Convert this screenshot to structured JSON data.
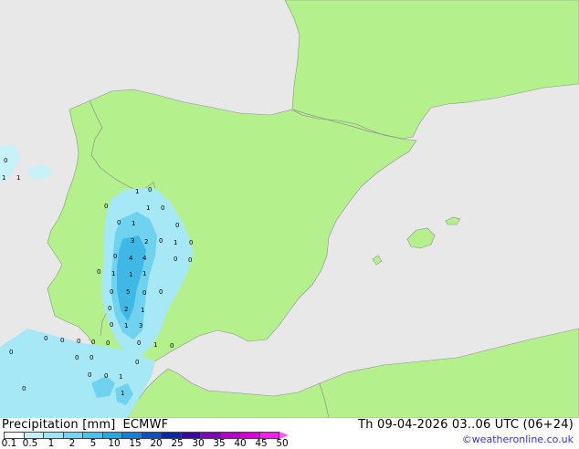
{
  "map": {
    "colors": {
      "sea": "#e8e8e8",
      "land": "#b4f08c",
      "border": "#909090",
      "rain_light": "#a6e8f5",
      "rain_mid": "#6fd2ee",
      "rain_heavy": "#3fb8e6"
    },
    "point_values": [
      "0",
      "1",
      "1",
      "1",
      "0",
      "0",
      "1",
      "0",
      "0",
      "1",
      "0",
      "3",
      "2",
      "0",
      "1",
      "0",
      "0",
      "4",
      "4",
      "0",
      "0",
      "1",
      "1",
      "1",
      "0",
      "0",
      "5",
      "0",
      "0",
      "2",
      "1",
      "0",
      "1",
      "3",
      "0",
      "0",
      "0",
      "0",
      "0",
      "0",
      "0",
      "0",
      "0",
      "0",
      "0",
      "1",
      "0",
      "0",
      "0",
      "1",
      "1",
      "0"
    ]
  },
  "legend": {
    "title": "Precipitation [mm]",
    "model": "ECMWF",
    "tick_labels": [
      "0.1",
      "0.5",
      "1",
      "2",
      "5",
      "10",
      "15",
      "20",
      "25",
      "30",
      "35",
      "40",
      "45",
      "50"
    ],
    "colors": [
      "#ffffff",
      "#c8f0fa",
      "#a0e4f6",
      "#78d4f2",
      "#50c0ea",
      "#2aa6e0",
      "#1880d0",
      "#1050b8",
      "#0a2aa0",
      "#3a0a9c",
      "#7a08b8",
      "#b004c8",
      "#d800d8",
      "#f020e8"
    ]
  },
  "run_info": "Th 09-04-2026 03..06 UTC (06+24)",
  "credit": "©weatheronline.co.uk"
}
